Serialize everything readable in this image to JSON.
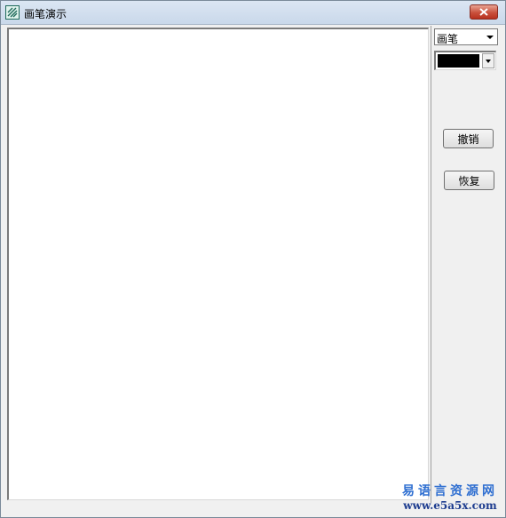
{
  "window": {
    "title": "画笔演示",
    "icon": "app-icon"
  },
  "titlebar": {
    "close_icon": "close-icon"
  },
  "tool_select": {
    "value": "画笔",
    "icon": "chevron-down-icon"
  },
  "color_select": {
    "color": "#000000",
    "icon": "chevron-down-icon"
  },
  "buttons": {
    "undo_label": "撤销",
    "redo_label": "恢复"
  },
  "watermark": {
    "name": "易语言资源网",
    "url": "www.e5a5x.com"
  }
}
